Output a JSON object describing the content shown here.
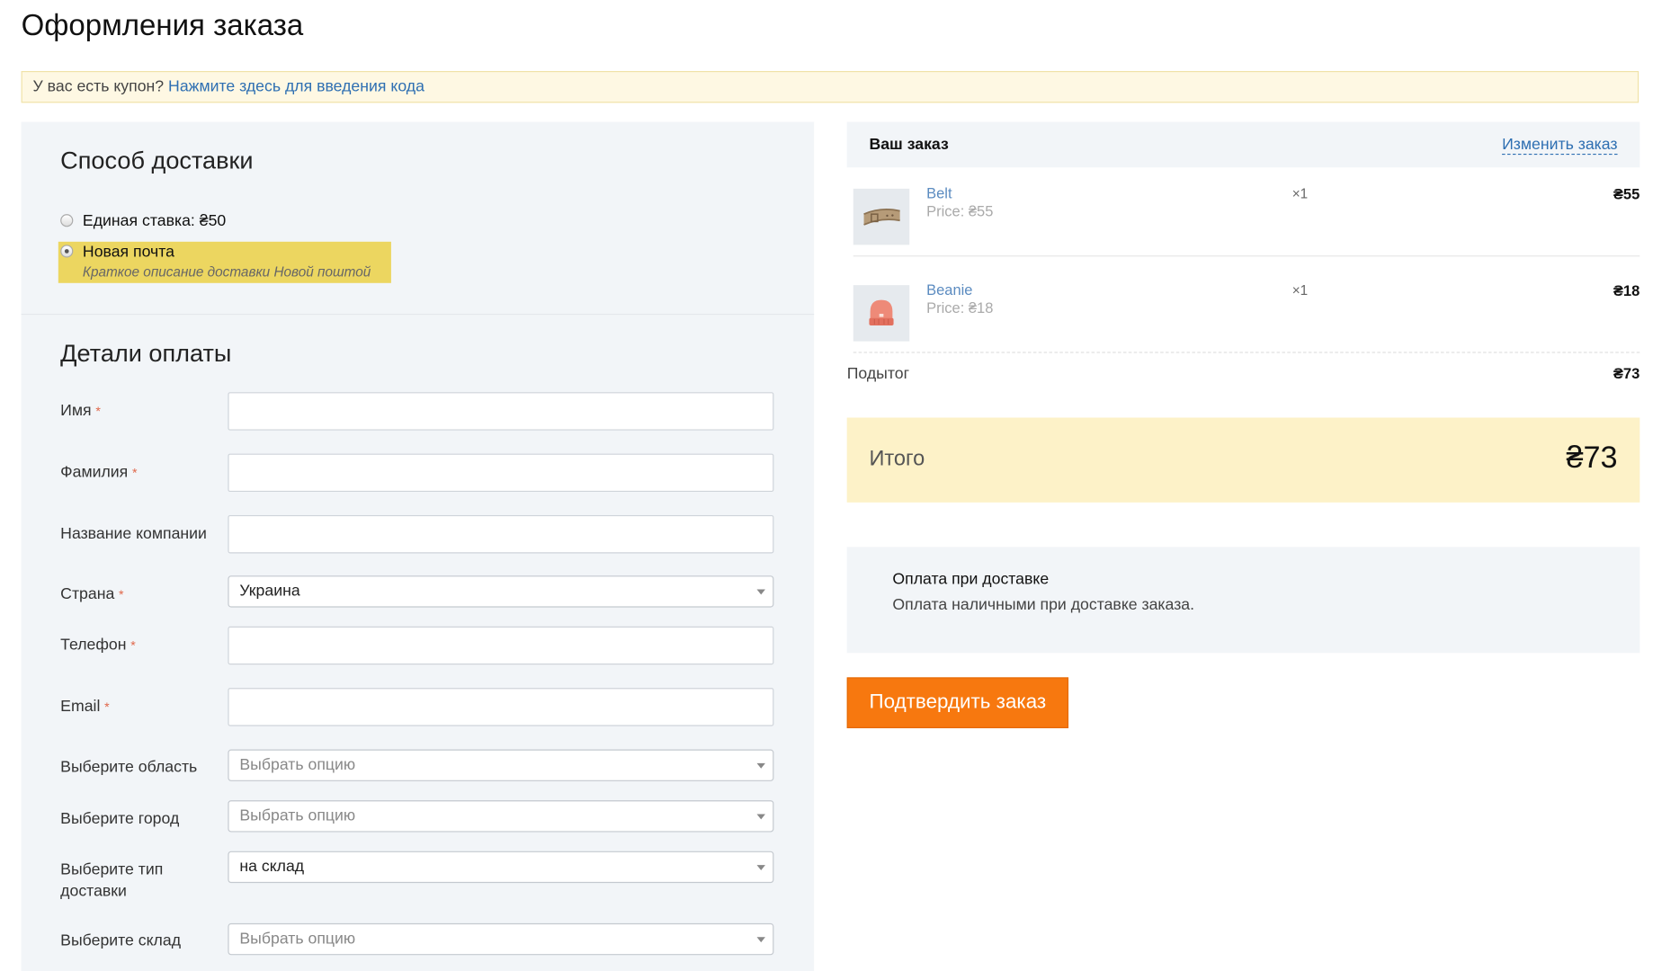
{
  "page": {
    "title": "Оформления заказа"
  },
  "coupon": {
    "text": "У вас есть купон?",
    "link": "Нажмите здесь для введения кода"
  },
  "shipping": {
    "heading": "Способ доставки",
    "options": [
      {
        "label": "Единая ставка: ₴50",
        "checked": false
      },
      {
        "label": "Новая почта",
        "description": "Краткое описание доставки Новой поштой",
        "checked": true
      }
    ]
  },
  "billing": {
    "heading": "Детали оплаты",
    "required_mark": "*",
    "fields": {
      "first_name": {
        "label": "Имя",
        "value": ""
      },
      "last_name": {
        "label": "Фамилия",
        "value": ""
      },
      "company": {
        "label": "Название компании",
        "value": ""
      },
      "country": {
        "label": "Страна",
        "value": "Украина"
      },
      "phone": {
        "label": "Телефон",
        "value": ""
      },
      "email": {
        "label": "Email",
        "value": ""
      },
      "region": {
        "label": "Выберите область",
        "placeholder": "Выбрать опцию"
      },
      "city": {
        "label": "Выберите город",
        "placeholder": "Выбрать опцию"
      },
      "delivery_type": {
        "label": "Выберите тип доставки",
        "value": "на склад"
      },
      "warehouse": {
        "label": "Выберите склад",
        "placeholder": "Выбрать опцию"
      }
    }
  },
  "order": {
    "heading": "Ваш заказ",
    "edit_link": "Изменить заказ",
    "items": [
      {
        "name": "Belt",
        "price": "Price: ₴55",
        "qty": "×1",
        "amount": "₴55",
        "icon": "belt-icon"
      },
      {
        "name": "Beanie",
        "price": "Price: ₴18",
        "qty": "×1",
        "amount": "₴18",
        "icon": "beanie-icon"
      }
    ],
    "subtotal_label": "Подытог",
    "subtotal": "₴73",
    "total_label": "Итого",
    "total": "₴73"
  },
  "payment": {
    "title": "Оплата при доставке",
    "description": "Оплата наличными при доставке заказа."
  },
  "confirm_button": "Подтвердить заказ",
  "colors": {
    "accent": "#f7780f",
    "link": "#2e6fb2",
    "panel": "#f2f5f8",
    "total_bg": "#fdf2c8",
    "highlight": "#ecd660"
  }
}
